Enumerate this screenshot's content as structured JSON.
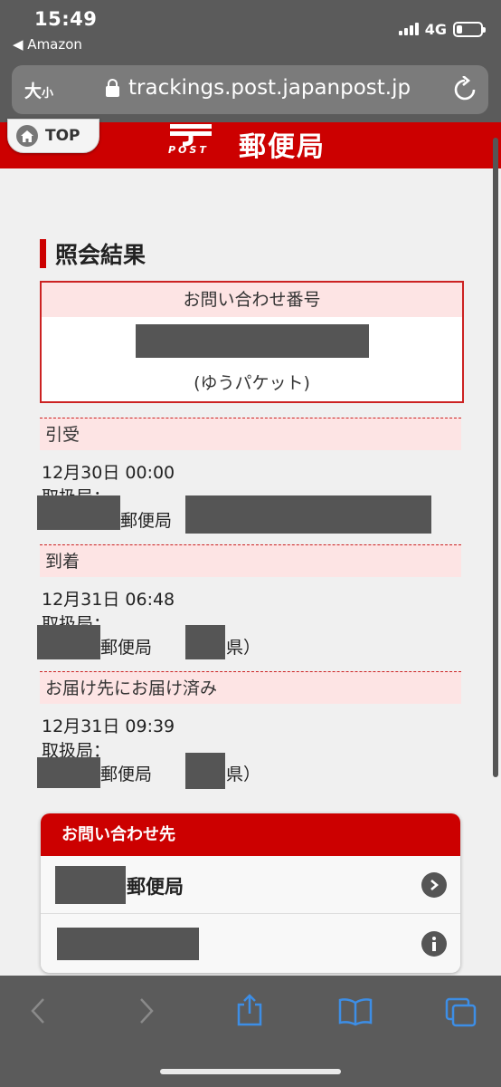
{
  "status_bar": {
    "time": "15:49",
    "back_app": "◀ Amazon",
    "network": "4G"
  },
  "url_bar": {
    "text_size_big": "大",
    "text_size_small": "小",
    "url": "trackings.post.japanpost.jp"
  },
  "header": {
    "top_label": "TOP",
    "logo_post": "POST",
    "logo_text": "郵便局"
  },
  "result": {
    "title": "照会結果",
    "inquiry_label": "お問い合わせ番号",
    "service_type": "(ゆうパケット)"
  },
  "events": [
    {
      "status": "引受",
      "datetime": "12月30日 00:00",
      "office_label": "取扱局：",
      "office_suffix": "郵便局"
    },
    {
      "status": "到着",
      "datetime": "12月31日 06:48",
      "office_label": "取扱局：",
      "office_suffix": "郵便局",
      "paren_open": "（",
      "pref_suffix": "県）"
    },
    {
      "status": "お届け先にお届け済み",
      "datetime": "12月31日 09:39",
      "office_label": "取扱局：",
      "office_suffix": "郵便局",
      "paren_open": "（",
      "pref_suffix": "県）"
    }
  ],
  "contact": {
    "heading": "お問い合わせ先",
    "office_suffix": "郵便局"
  },
  "colors": {
    "brand_red": "#cc0000",
    "pink_band": "#fde4e4",
    "redaction": "#555555"
  },
  "icons": [
    "lock-icon",
    "reload-icon",
    "home-icon",
    "chevron-right-icon",
    "info-icon",
    "back-icon",
    "forward-icon",
    "share-icon",
    "bookmarks-icon",
    "tabs-icon"
  ]
}
